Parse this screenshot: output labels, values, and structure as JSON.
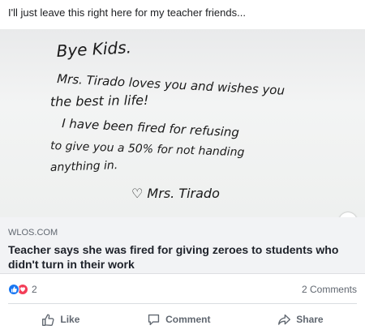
{
  "post": {
    "text": "I'll just leave this right here for my teacher friends..."
  },
  "whiteboard": {
    "lines": [
      "Bye Kids.",
      "Mrs. Tirado loves you and wishes you",
      "the best in life!",
      "I have been fired for refusing",
      "to give you a 50% for not handing",
      "anything in.",
      "♡ Mrs. Tirado"
    ]
  },
  "link": {
    "domain": "WLOS.COM",
    "title": "Teacher says she was fired for giving zeroes to students who didn't turn in their work",
    "info_icon": "i"
  },
  "reactions": {
    "count": "2",
    "comments": "2 Comments",
    "icons": [
      "like-icon",
      "love-icon"
    ]
  },
  "actions": {
    "like": "Like",
    "comment": "Comment",
    "share": "Share"
  },
  "colors": {
    "like_blue": "#1877f2",
    "love_red": "#f33e58",
    "meta_bg": "#f2f3f5",
    "muted_text": "#606770"
  }
}
